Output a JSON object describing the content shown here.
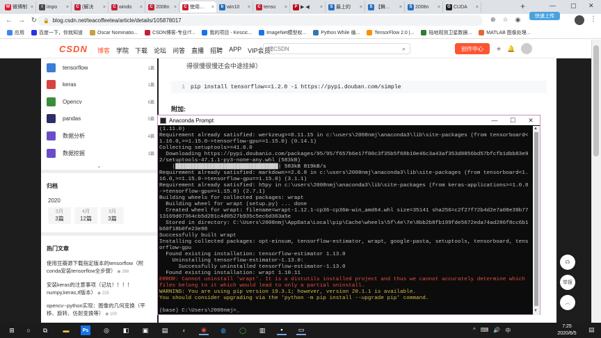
{
  "browser": {
    "tabs": [
      {
        "label": "微博制",
        "color": "#e6162d",
        "glyph": "W"
      },
      {
        "label": "impo",
        "color": "#4b4b4b",
        "glyph": "i"
      },
      {
        "label": "(解决",
        "color": "#c32136",
        "glyph": "C"
      },
      {
        "label": "windo",
        "color": "#c32136",
        "glyph": "C"
      },
      {
        "label": "2008n",
        "color": "#c32136",
        "glyph": "C"
      },
      {
        "label": "使用…",
        "color": "#c32136",
        "glyph": "C"
      },
      {
        "label": "win10",
        "color": "#2a6ebb",
        "glyph": "b"
      },
      {
        "label": "tenso",
        "color": "#c32136",
        "glyph": "C"
      },
      {
        "label": "▶ ◀",
        "color": "#bd081c",
        "glyph": "P"
      },
      {
        "label": "最上的",
        "color": "#2a6ebb",
        "glyph": "S"
      },
      {
        "label": "【舞…",
        "color": "#2a6ebb",
        "glyph": "S"
      },
      {
        "label": "2008n",
        "color": "#2a6ebb",
        "glyph": "S"
      },
      {
        "label": "CUDA",
        "color": "#222222",
        "glyph": "G"
      }
    ],
    "new_tab": "+",
    "url": "blog.csdn.net/teacoffeetea/article/details/105878017",
    "float_button": "快速上传",
    "bookmarks": [
      {
        "label": "应用",
        "color": "#4285f4"
      },
      {
        "label": "百度一下，你就知道",
        "color": "#2932e1"
      },
      {
        "label": "Oscar Nominatio...",
        "color": "#c8a046"
      },
      {
        "label": "CSDN博客-专业IT...",
        "color": "#c32136"
      },
      {
        "label": "我的项目 - Kescic...",
        "color": "#1a73e8"
      },
      {
        "label": "ImageNet模型权...",
        "color": "#1a73e8"
      },
      {
        "label": "Python While 循...",
        "color": "#3776ab"
      },
      {
        "label": "TensorFlow 2.0 |...",
        "color": "#ff8f00"
      },
      {
        "label": "陆地观测卫星数据...",
        "color": "#2e7d32"
      },
      {
        "label": "MATLAB 图像处理...",
        "color": "#e16737"
      }
    ]
  },
  "csdn": {
    "logo": "CSDN",
    "nav": [
      "博客",
      "学院",
      "下载",
      "论坛",
      "问答",
      "直播",
      "招聘",
      "APP",
      "VIP会员"
    ],
    "search_placeholder": "搜CSDN",
    "create_button": "创作中心",
    "sidebar": {
      "tags": [
        {
          "label": "tensorflow",
          "count": "1篇",
          "color": "#3b7dd8"
        },
        {
          "label": "keras",
          "count": "1篇",
          "color": "#d7443e"
        },
        {
          "label": "Opencv",
          "count": "6篇",
          "color": "#3a8d3a"
        },
        {
          "label": "pandas",
          "count": "5篇",
          "color": "#2d2d6b"
        },
        {
          "label": "数据分析",
          "count": "4篇",
          "color": "#6b4ec7"
        },
        {
          "label": "数据挖掘",
          "count": "3篇",
          "color": "#6b4ec7"
        }
      ],
      "archive_title": "归档",
      "year": "2020",
      "months": [
        {
          "month": "5月",
          "count": "3篇"
        },
        {
          "month": "4月",
          "count": "12篇"
        },
        {
          "month": "3月",
          "count": "3篇"
        }
      ],
      "hot_title": "热门文章",
      "hot": [
        {
          "title": "使用豆瓣源下载指定版本的tensorflow（附conda安装tensorflow全步骤）",
          "views": "268"
        },
        {
          "title": "安装keras的注意事项（记坑！！！！numpy,keras,tf版本）",
          "views": "225"
        },
        {
          "title": "opencv--python实现：图像的几何变换（平移、旋转、仿射变换等）",
          "views": "100"
        }
      ]
    },
    "article": {
      "text_line": "得很慢很慢还会中途挂掉）",
      "code_line_no": "1",
      "code_cmd": "pip install tensorflow==1.2.0 -i https://pypi.douban.com/simple",
      "heading": "附加:"
    },
    "right_tools": [
      "☊",
      "举报",
      "︿"
    ]
  },
  "terminal": {
    "title": "Anaconda Prompt",
    "lines": [
      {
        "t": "(1.11.0)",
        "k": "n"
      },
      {
        "t": "Requirement already satisfied: werkzeug>=0.11.15 in c:\\users\\2008nmj\\anaconda3\\lib\\site-packages (from tensorboard<1.16.0,>=1.15.0->tensorflow-gpu==1.15.0) (0.14.1)",
        "k": "n"
      },
      {
        "t": "Collecting setuptools>=41.0.0",
        "k": "n"
      },
      {
        "t": "  Downloading https://pypi.doubanio.com/packages/95/95/f657b6e17f00c3f35b5f68b10e46c3a43af353d8856bd57bfcfb1dbb83e92/setuptools-47.1.1-py3-none-any.whl (583kB)",
        "k": "n"
      },
      {
        "t": "    |████████████████████████████████| 583kB 819kB/s",
        "k": "b"
      },
      {
        "t": "Requirement already satisfied: markdown>=2.6.8 in c:\\users\\2008nmj\\anaconda3\\lib\\site-packages (from tensorboard<1.16.0,>=1.15.0->tensorflow-gpu==1.15.0) (3.1.1)",
        "k": "n"
      },
      {
        "t": "Requirement already satisfied: h5py in c:\\users\\2008nmj\\anaconda3\\lib\\site-packages (from keras-applications>=1.0.8->tensorflow-gpu==1.15.0) (2.7.1)",
        "k": "n"
      },
      {
        "t": "Building wheels for collected packages: wrapt",
        "k": "n"
      },
      {
        "t": "  Building wheel for wrapt (setup.py) ... done",
        "k": "n"
      },
      {
        "t": "  Created wheel for wrapt: filename=wrapt-1.12.1-cp36-cp36m-win_amd64.whl size=35141 sha256=c2f27f72b4d2e7a08e39b7713169d67364cb5d281c4d0527b935c5ec6d363a5e",
        "k": "n"
      },
      {
        "t": "  Stored in directory: C:\\Users\\2008nmj\\AppData\\Local\\pip\\Cache\\wheels\\5f\\4e\\7e\\8bb2b8fb199fde5672eda74ad286f8cc6b1b60f18b0fe23e98",
        "k": "n"
      },
      {
        "t": "Successfully built wrapt",
        "k": "n"
      },
      {
        "t": "Installing collected packages: opt-einsum, tensorflow-estimator, wrapt, google-pasta, setuptools, tensorboard, tensorflow-gpu",
        "k": "n"
      },
      {
        "t": "  Found existing installation: tensorflow-estimator 1.13.0",
        "k": "n"
      },
      {
        "t": "    Uninstalling tensorflow-estimator-1.13.0:",
        "k": "n"
      },
      {
        "t": "      Successfully uninstalled tensorflow-estimator-1.13.0",
        "k": "n"
      },
      {
        "t": "  Found existing installation: wrapt 1.10.11",
        "k": "n"
      },
      {
        "t": "ERROR: Cannot uninstall 'wrapt'. It is a distutils installed project and thus we cannot accurately determine which files belong to it which would lead to only a partial uninstall.",
        "k": "e"
      },
      {
        "t": "WARNING: You are using pip version 19.3.1; however, version 20.1.1 is available.",
        "k": "w"
      },
      {
        "t": "You should consider upgrading via the 'python -m pip install --upgrade pip' command.",
        "k": "w"
      },
      {
        "t": "",
        "k": "n"
      },
      {
        "t": "(base) C:\\Users\\2008nmj>",
        "k": "n"
      }
    ]
  },
  "taskbar": {
    "time": "7:25",
    "date": "2020/6/5",
    "tray": [
      "^",
      "⌨",
      "🔊",
      "中"
    ]
  }
}
